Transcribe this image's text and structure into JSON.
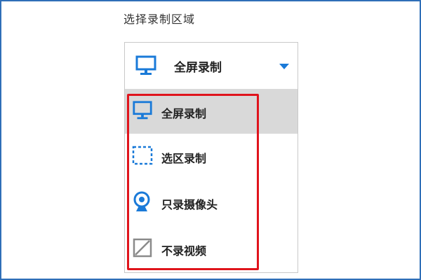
{
  "section": {
    "label": "选择录制区域"
  },
  "select": {
    "value": "全屏录制",
    "icon": "monitor-icon",
    "caret_icon": "caret-down-icon"
  },
  "options": [
    {
      "label": "全屏录制",
      "icon": "monitor-icon",
      "selected": true
    },
    {
      "label": "选区录制",
      "icon": "dashed-selection-icon",
      "selected": false
    },
    {
      "label": "只录摄像头",
      "icon": "webcam-icon",
      "selected": false
    },
    {
      "label": "不录视频",
      "icon": "no-video-icon",
      "selected": false
    }
  ],
  "colors": {
    "accent": "#1a7ad8",
    "highlight_border": "#e0141c",
    "selected_bg": "#d9d9d9",
    "frame_border": "#2f6fb8"
  }
}
